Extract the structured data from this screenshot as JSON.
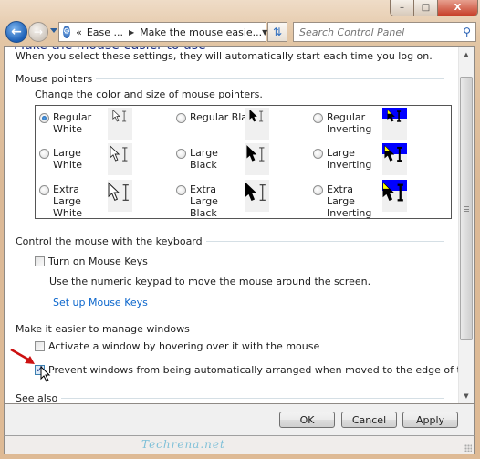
{
  "window": {
    "controls": {
      "minimize": "–",
      "maximize": "□",
      "close": "X"
    }
  },
  "nav": {
    "back_icon": "back-arrow-icon",
    "forward_icon": "forward-arrow-icon",
    "breadcrumbs": [
      "Ease ...",
      "Make the mouse easie..."
    ],
    "breadcrumb_prefix": "«",
    "refresh_icon": "refresh-icon",
    "search_placeholder": "Search Control Panel"
  },
  "page": {
    "title_cut": "Make the mouse easier to use",
    "intro": "When you select these settings, they will automatically start each time you log on."
  },
  "sections": {
    "pointers": {
      "heading": "Mouse pointers",
      "description": "Change the color and size of mouse pointers.",
      "options": [
        {
          "label": "Regular White",
          "lines": [
            "Regular",
            "White"
          ],
          "checked": true,
          "style": "white",
          "size": "regular"
        },
        {
          "label": "Regular Black",
          "lines": [
            "Regular Black"
          ],
          "checked": false,
          "style": "black",
          "size": "regular"
        },
        {
          "label": "Regular Inverting",
          "lines": [
            "Regular",
            "Inverting"
          ],
          "checked": false,
          "style": "inverting",
          "size": "regular"
        },
        {
          "label": "Large White",
          "lines": [
            "Large White"
          ],
          "checked": false,
          "style": "white",
          "size": "large"
        },
        {
          "label": "Large Black",
          "lines": [
            "Large Black"
          ],
          "checked": false,
          "style": "black",
          "size": "large"
        },
        {
          "label": "Large Inverting",
          "lines": [
            "Large",
            "Inverting"
          ],
          "checked": false,
          "style": "inverting",
          "size": "large"
        },
        {
          "label": "Extra Large White",
          "lines": [
            "Extra Large",
            "White"
          ],
          "checked": false,
          "style": "white",
          "size": "xlarge"
        },
        {
          "label": "Extra Large Black",
          "lines": [
            "Extra Large",
            "Black"
          ],
          "checked": false,
          "style": "black",
          "size": "xlarge"
        },
        {
          "label": "Extra Large Inverting",
          "lines": [
            "Extra Large",
            "Inverting"
          ],
          "checked": false,
          "style": "inverting",
          "size": "xlarge"
        }
      ]
    },
    "keyboard": {
      "heading": "Control the mouse with the keyboard",
      "checkbox_label": "Turn on Mouse Keys",
      "checkbox_checked": false,
      "description": "Use the numeric keypad to move the mouse around the screen.",
      "link": "Set up Mouse Keys"
    },
    "windows": {
      "heading": "Make it easier to manage windows",
      "items": [
        {
          "label": "Activate a window by hovering over it with the mouse",
          "checked": false
        },
        {
          "label": "Prevent windows from being automatically arranged when moved to the edge of the screen",
          "checked": true
        }
      ]
    },
    "see_also": {
      "heading": "See also"
    }
  },
  "buttons": {
    "ok": "OK",
    "cancel": "Cancel",
    "apply": "Apply"
  },
  "watermark": "Techrena.net",
  "colors": {
    "link": "#0b66cc",
    "title": "#1e3287",
    "annotation_arrow": "#cc1111",
    "inverting_bg": "#0000ff"
  }
}
